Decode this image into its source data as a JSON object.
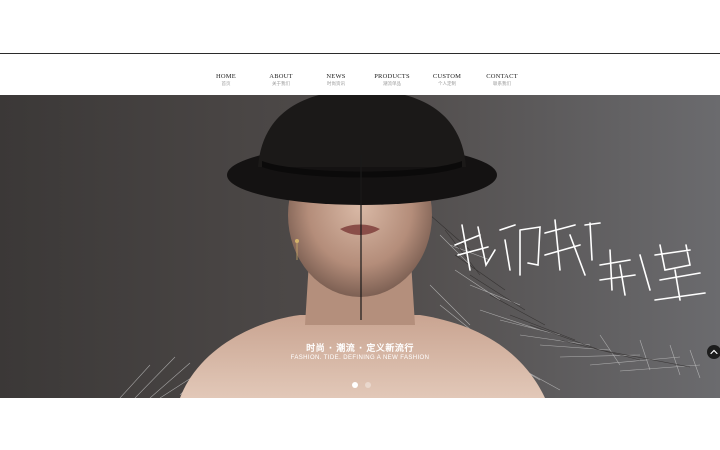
{
  "nav": {
    "items": [
      {
        "en": "HOME",
        "zh": "首页"
      },
      {
        "en": "ABOUT",
        "zh": "关于我们"
      },
      {
        "en": "NEWS",
        "zh": "时尚资讯"
      },
      {
        "en": "PRODUCTS",
        "zh": "潮流单品"
      },
      {
        "en": "CUSTOM",
        "zh": "个人定制"
      },
      {
        "en": "CONTACT",
        "zh": "联系我们"
      }
    ]
  },
  "hero": {
    "handwritten_line1": "我们超",
    "handwritten_line2": "新星",
    "tagline_zh": "时尚 · 潮流 · 定义新流行",
    "tagline_en": "FASHION. TIDE. DEFINING A NEW FASHION",
    "slides_total": 2,
    "active_slide": 1
  },
  "icons": {
    "scroll_top": "chevron-up-icon"
  }
}
